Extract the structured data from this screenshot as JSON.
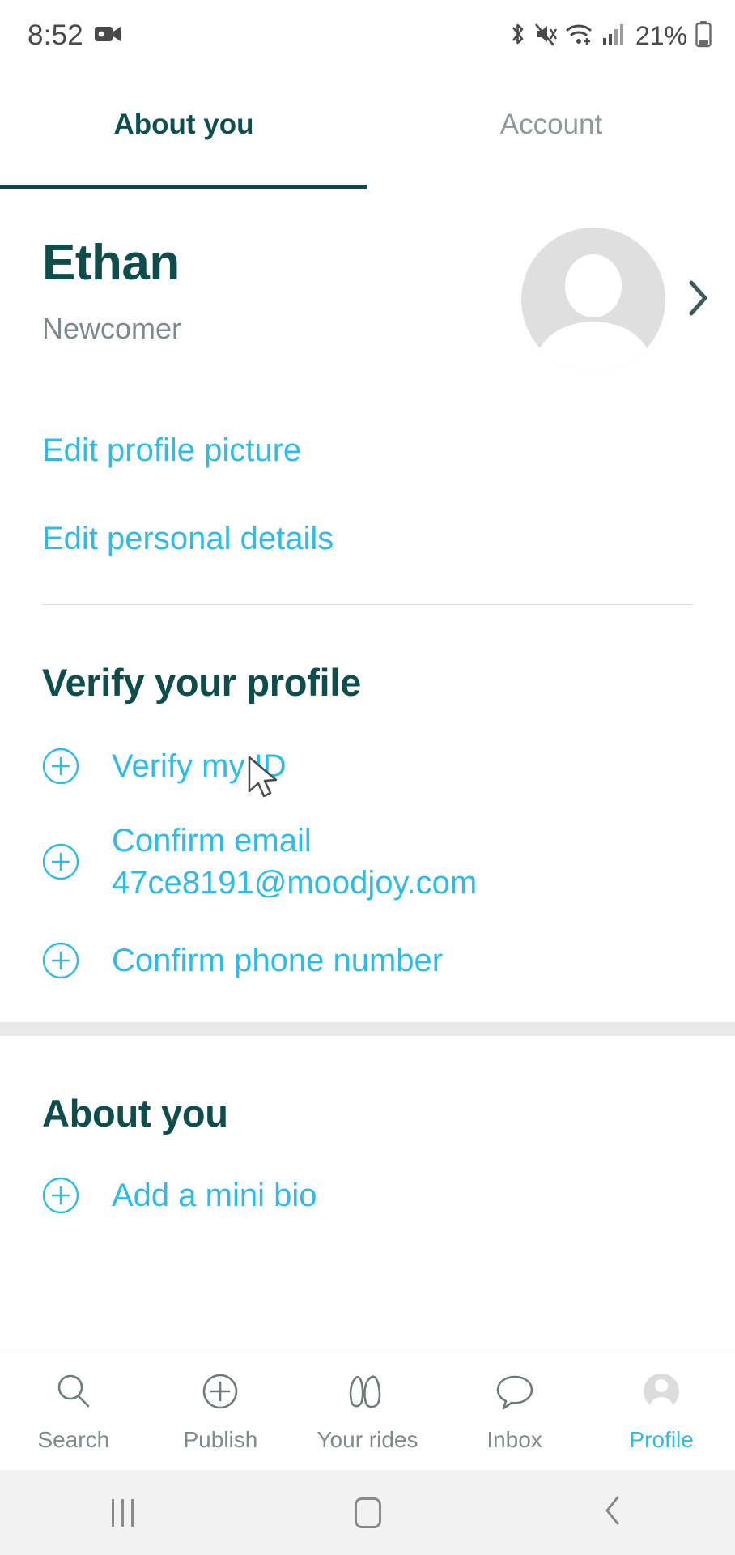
{
  "status_bar": {
    "time": "8:52",
    "battery_percent": "21%",
    "icons": [
      "video-camera-icon",
      "bluetooth-icon",
      "vibrate-mute-icon",
      "wifi-icon",
      "cellular-signal-icon",
      "battery-icon"
    ]
  },
  "tabs": [
    {
      "label": "About you",
      "active": true
    },
    {
      "label": "Account",
      "active": false
    }
  ],
  "profile": {
    "name": "Ethan",
    "status": "Newcomer",
    "avatar_icon": "default-avatar-icon",
    "chevron_icon": "chevron-right-icon",
    "links": [
      {
        "label": "Edit profile picture"
      },
      {
        "label": "Edit personal details"
      }
    ]
  },
  "verify_section": {
    "title": "Verify your profile",
    "items": [
      {
        "label": "Verify my ID",
        "icon": "plus-circle-icon"
      },
      {
        "label": "Confirm email 47ce8191@moodjoy.com",
        "icon": "plus-circle-icon"
      },
      {
        "label": "Confirm phone number",
        "icon": "plus-circle-icon"
      }
    ]
  },
  "about_section": {
    "title": "About you",
    "items": [
      {
        "label": "Add a mini bio",
        "icon": "plus-circle-icon"
      }
    ]
  },
  "bottom_nav": [
    {
      "label": "Search",
      "icon": "search-icon",
      "active": false
    },
    {
      "label": "Publish",
      "icon": "plus-circle-icon",
      "active": false
    },
    {
      "label": "Your rides",
      "icon": "rides-icon",
      "active": false
    },
    {
      "label": "Inbox",
      "icon": "chat-bubble-icon",
      "active": false
    },
    {
      "label": "Profile",
      "icon": "avatar-icon",
      "active": true
    }
  ],
  "android_nav": [
    {
      "icon": "recents-icon"
    },
    {
      "icon": "home-icon"
    },
    {
      "icon": "back-icon"
    }
  ],
  "colors": {
    "accent_cyan": "#2fbbe8",
    "dark_teal": "#0f4c4c",
    "muted_gray": "#7b8a8a",
    "band_gray": "#e9e9e9"
  }
}
